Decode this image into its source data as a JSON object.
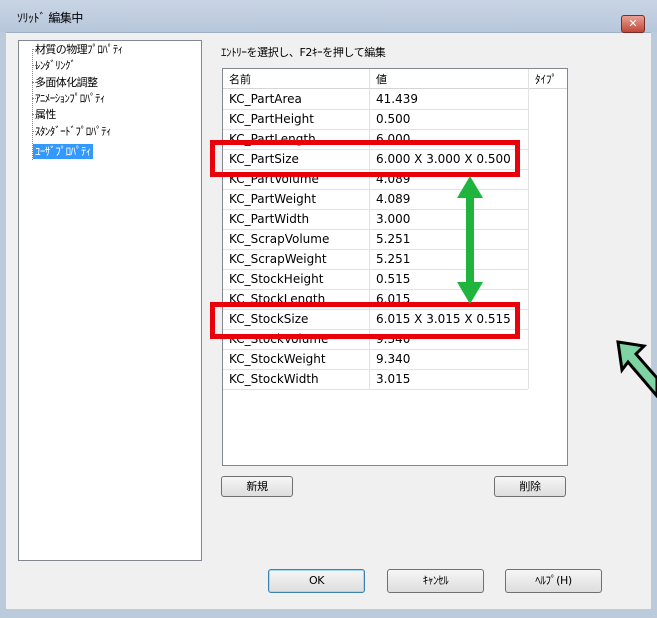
{
  "window": {
    "title": "ｿﾘｯﾄﾞ 編集中",
    "close_label": "✕"
  },
  "tree": {
    "items": [
      {
        "label": "材質の物理ﾌﾟﾛﾊﾟﾃｨ"
      },
      {
        "label": "ﾚﾝﾀﾞﾘﾝｸﾞ"
      },
      {
        "label": "多面体化調整"
      },
      {
        "label": "ｱﾆﾒｰｼｮﾝﾌﾟﾛﾊﾟﾃｨ"
      },
      {
        "label": "属性"
      },
      {
        "label": "ｽﾀﾝﾀﾞｰﾄﾞﾌﾟﾛﾊﾟﾃｨ"
      },
      {
        "label": "ﾕｰｻﾞﾌﾟﾛﾊﾟﾃｨ"
      }
    ]
  },
  "instruction": "ｴﾝﾄﾘｰを選択し、F2ｷｰを押して編集",
  "grid": {
    "headers": {
      "name": "名前",
      "value": "値",
      "type": "ﾀｲﾌﾟ"
    },
    "rows": [
      {
        "name": "KC_PartArea",
        "value": "41.439"
      },
      {
        "name": "KC_PartHeight",
        "value": "0.500"
      },
      {
        "name": "KC_PartLength",
        "value": "6.000"
      },
      {
        "name": "KC_PartSize",
        "value": "6.000 X 3.000 X 0.500"
      },
      {
        "name": "KC_PartVolume",
        "value": "4.089"
      },
      {
        "name": "KC_PartWeight",
        "value": "4.089"
      },
      {
        "name": "KC_PartWidth",
        "value": "3.000"
      },
      {
        "name": "KC_ScrapVolume",
        "value": "5.251"
      },
      {
        "name": "KC_ScrapWeight",
        "value": "5.251"
      },
      {
        "name": "KC_StockHeight",
        "value": "0.515"
      },
      {
        "name": "KC_StockLength",
        "value": "6.015"
      },
      {
        "name": "KC_StockSize",
        "value": "6.015 X 3.015 X 0.515"
      },
      {
        "name": "KC_StockVolume",
        "value": "9.340"
      },
      {
        "name": "KC_StockWeight",
        "value": "9.340"
      },
      {
        "name": "KC_StockWidth",
        "value": "3.015"
      }
    ]
  },
  "buttons": {
    "new": "新規",
    "delete": "削除",
    "ok": "OK",
    "cancel": "ｷｬﾝｾﾙ",
    "help": "ﾍﾙﾌﾟ(H)"
  },
  "annotations": {
    "highlight_color": "#e8000b",
    "arrow_color": "#1fb53c",
    "pointer_arrow_color": "#7ed3a3"
  }
}
